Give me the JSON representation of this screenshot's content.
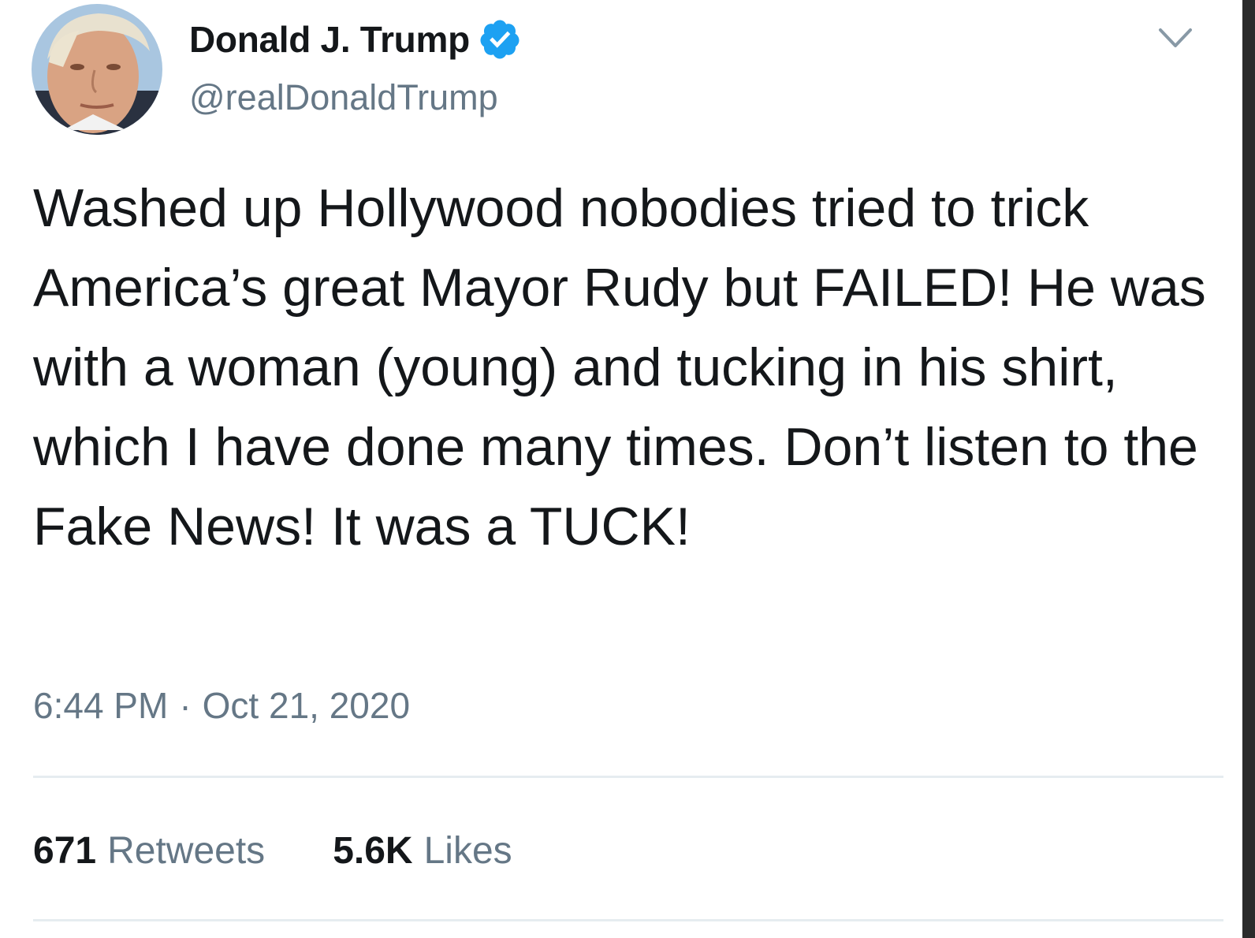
{
  "tweet": {
    "author": {
      "display_name": "Donald J. Trump",
      "handle": "@realDonaldTrump",
      "verified": true,
      "avatar_icon": "profile-photo"
    },
    "text": "Washed up Hollywood nobodies tried to trick America’s great Mayor Rudy but FAILED! He was with a woman (young) and tucking in his shirt, which I have done many times. Don’t listen to the Fake News! It was a TUCK!",
    "time": "6:44 PM",
    "separator": "·",
    "date": "Oct 21, 2020",
    "stats": {
      "retweets_count": "671",
      "retweets_label": "Retweets",
      "likes_count": "5.6K",
      "likes_label": "Likes"
    }
  },
  "colors": {
    "primary_text": "#14171a",
    "secondary_text": "#657786",
    "verified_blue": "#1da1f2",
    "divider": "#e6ecf0"
  },
  "icons": {
    "verified": "verified-badge-icon",
    "menu": "chevron-down-icon"
  }
}
